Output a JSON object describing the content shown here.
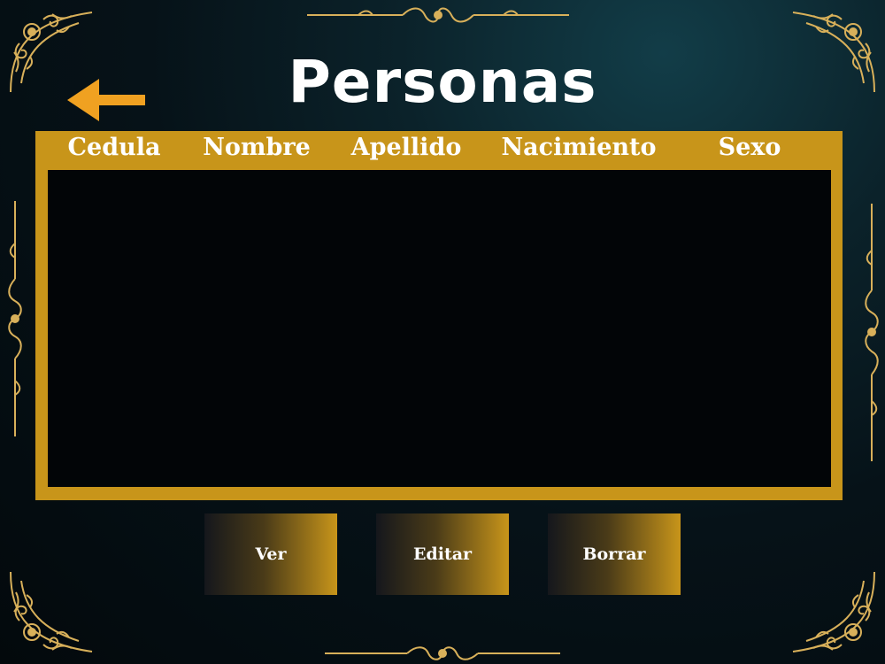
{
  "page": {
    "title": "Personas"
  },
  "back": {
    "icon": "arrow-left-icon",
    "color": "#f0a121"
  },
  "table": {
    "columns": [
      "Cedula",
      "Nombre",
      "Apellido",
      "Nacimiento",
      "Sexo"
    ],
    "rows": [],
    "frame_color": "#c8951a"
  },
  "actions": {
    "view_label": "Ver",
    "edit_label": "Editar",
    "delete_label": "Borrar"
  },
  "theme": {
    "ornament_color": "#d8b05a",
    "background": "#061218"
  }
}
